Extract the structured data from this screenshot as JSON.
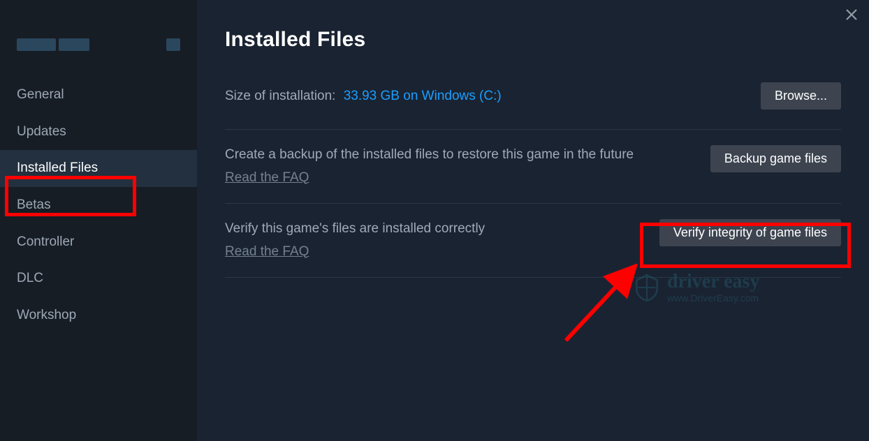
{
  "sidebar": {
    "items": [
      {
        "label": "General",
        "active": false
      },
      {
        "label": "Updates",
        "active": false
      },
      {
        "label": "Installed Files",
        "active": true
      },
      {
        "label": "Betas",
        "active": false
      },
      {
        "label": "Controller",
        "active": false
      },
      {
        "label": "DLC",
        "active": false
      },
      {
        "label": "Workshop",
        "active": false
      }
    ]
  },
  "page": {
    "title": "Installed Files",
    "size_label": "Size of installation:",
    "size_value": "33.93 GB on Windows (C:)",
    "browse_label": "Browse...",
    "backup": {
      "text": "Create a backup of the installed files to restore this game in the future",
      "faq": "Read the FAQ",
      "button": "Backup game files"
    },
    "verify": {
      "text": "Verify this game's files are installed correctly",
      "faq": "Read the FAQ",
      "button": "Verify integrity of game files"
    }
  },
  "watermark": {
    "title": "driver easy",
    "url": "www.DriverEasy.com"
  }
}
